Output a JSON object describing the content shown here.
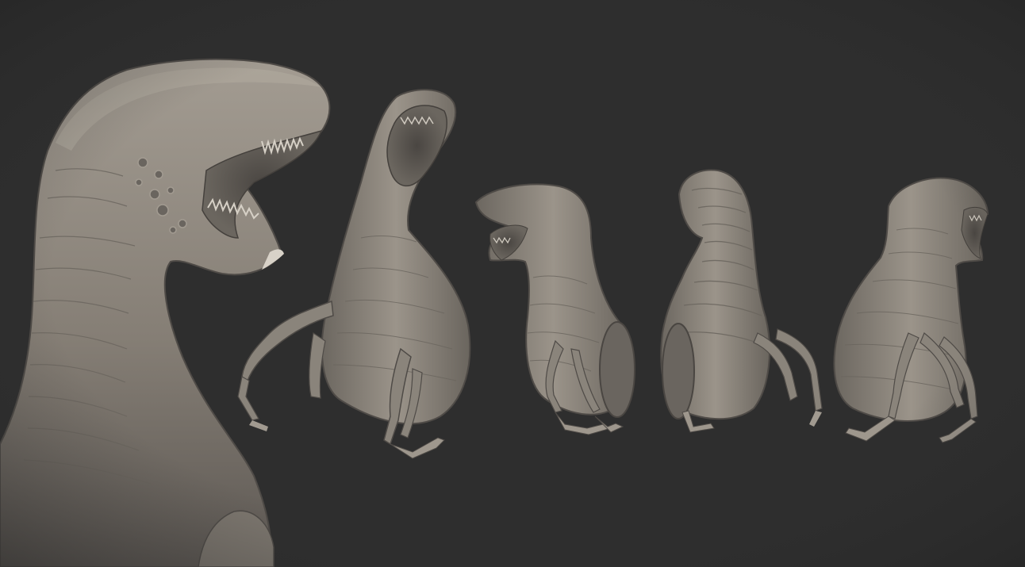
{
  "scene": {
    "subject": "creature-sculpt-turnaround",
    "background_color": "#2e2e2e",
    "clay_color": "#8c857c",
    "clay_shadow": "#5a5550",
    "clay_highlight": "#b4ada3",
    "views": [
      {
        "id": "closeup",
        "icon": "creature-head-closeup"
      },
      {
        "id": "front-left",
        "icon": "creature-front-left"
      },
      {
        "id": "side-left",
        "icon": "creature-side-left"
      },
      {
        "id": "back",
        "icon": "creature-back"
      },
      {
        "id": "side-right",
        "icon": "creature-side-right"
      }
    ]
  }
}
